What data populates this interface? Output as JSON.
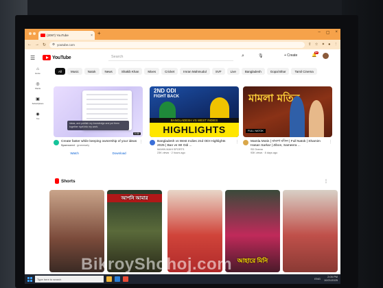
{
  "browser": {
    "tab_title": "(2097) YouTube",
    "tab_close": "×",
    "new_tab": "+",
    "url": "youtube.com",
    "nav": {
      "back": "←",
      "forward": "→",
      "reload": "↻"
    },
    "window_controls": [
      "–",
      "▢",
      "×"
    ]
  },
  "header": {
    "menu": "☰",
    "logo_text": "YouTube",
    "search_placeholder": "Search",
    "search_icon": "⌕",
    "mic_icon": "🎤",
    "create_label": "+ Create",
    "notifications_count": "9+"
  },
  "sidebar": {
    "items": [
      {
        "icon": "⌂",
        "label": "Home"
      },
      {
        "icon": "◎",
        "label": "Shorts"
      },
      {
        "icon": "▣",
        "label": "Subscriptions"
      },
      {
        "icon": "◉",
        "label": "You"
      }
    ]
  },
  "chips": [
    "All",
    "Music",
    "Natok",
    "News",
    "Shakib Khan",
    "Mixes",
    "Cricket",
    "Imran Mahmudul",
    "SVF",
    "Live",
    "Bangladesh",
    "Gopal Bhar",
    "Tamil Cinema"
  ],
  "videos": [
    {
      "type": "ad",
      "title": "Create faster while keeping ownership of your ideas",
      "sponsor": "Sponsored",
      "sponsor_detail": "· grammarly",
      "overlay_text": "ideas, and publish my knowledge and put them together right into my work.",
      "duration": "0:30",
      "actions": [
        "Watch",
        "Download"
      ]
    },
    {
      "type": "video",
      "thumb_top": "2ND ODI",
      "thumb_sub": "FIGHT BACK",
      "thumb_band": "BANGLADESH VS WEST INDIES",
      "thumb_big": "HIGHLIGHTS",
      "title": "Bangladesh vs West Indies 2nd ODI Highlights 2025 | Ban vs WI Odi ...",
      "channel": "MAHIN MAHI SPORTS",
      "stats": "23K views · 2 hours ago"
    },
    {
      "type": "video",
      "thumb_title": "মামলা মতিন",
      "thumb_bottom": "FULL NATOK",
      "title": "Mamla Motin | মামলা মতিন | Full Natok | Shamim Hasan Sarkar | Zibon, Sameera ...",
      "channel": "SD Drama",
      "stats": "93K views · 8 days ago"
    }
  ],
  "shorts": {
    "heading": "Shorts",
    "items": [
      {
        "caption": ""
      },
      {
        "caption": "আপনি আমার"
      },
      {
        "caption": ""
      },
      {
        "caption": "আহারে মিনি"
      },
      {
        "caption": ""
      }
    ]
  },
  "taskbar": {
    "search_placeholder": "Type here to search",
    "tray_lang": "ENG",
    "time": "2:05 PM",
    "date": "10/21/2025"
  },
  "watermark": "BikroyShohoj.com",
  "colors": {
    "brand": "#ff0000",
    "tab_bar": "#f6a24a",
    "chip_active": "#0f0f0f",
    "link": "#065fd4"
  }
}
